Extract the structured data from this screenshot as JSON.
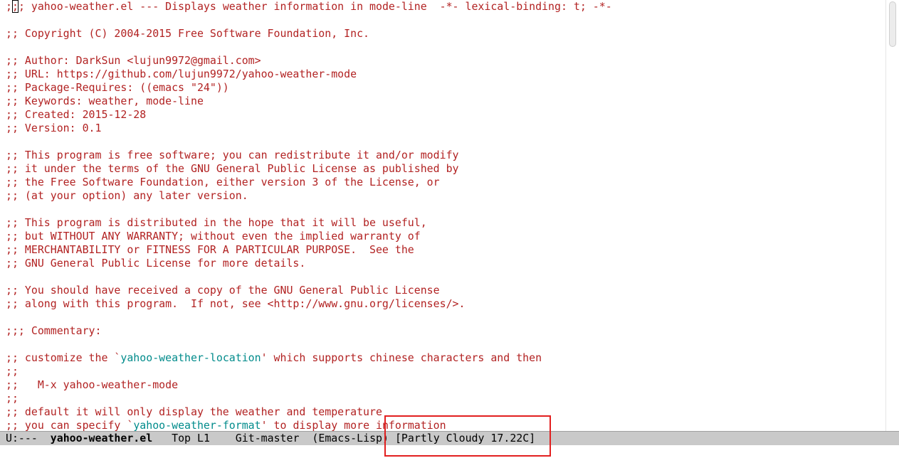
{
  "buffer": {
    "lines": [
      [
        {
          "text": ";",
          "cls": "comment"
        },
        {
          "text": ";",
          "cls": "comment cursor-char"
        },
        {
          "text": "; yahoo-weather.el --- Displays weather information in mode-line  -*- lexical-binding: t; -*-",
          "cls": "comment"
        }
      ],
      [],
      [
        {
          "text": ";; Copyright (C) 2004-2015 Free Software Foundation, Inc.",
          "cls": "comment"
        }
      ],
      [],
      [
        {
          "text": ";; Author: DarkSun <lujun9972@gmail.com>",
          "cls": "comment"
        }
      ],
      [
        {
          "text": ";; URL: https://github.com/lujun9972/yahoo-weather-mode",
          "cls": "comment"
        }
      ],
      [
        {
          "text": ";; Package-Requires: ((emacs \"24\"))",
          "cls": "comment"
        }
      ],
      [
        {
          "text": ";; Keywords: weather, mode-line",
          "cls": "comment"
        }
      ],
      [
        {
          "text": ";; Created: 2015-12-28",
          "cls": "comment"
        }
      ],
      [
        {
          "text": ";; Version: 0.1",
          "cls": "comment"
        }
      ],
      [],
      [
        {
          "text": ";; This program is free software; you can redistribute it and/or modify",
          "cls": "comment"
        }
      ],
      [
        {
          "text": ";; it under the terms of the GNU General Public License as published by",
          "cls": "comment"
        }
      ],
      [
        {
          "text": ";; the Free Software Foundation, either version 3 of the License, or",
          "cls": "comment"
        }
      ],
      [
        {
          "text": ";; (at your option) any later version.",
          "cls": "comment"
        }
      ],
      [],
      [
        {
          "text": ";; This program is distributed in the hope that it will be useful,",
          "cls": "comment"
        }
      ],
      [
        {
          "text": ";; but WITHOUT ANY WARRANTY; without even the implied warranty of",
          "cls": "comment"
        }
      ],
      [
        {
          "text": ";; MERCHANTABILITY or FITNESS FOR A PARTICULAR PURPOSE.  See the",
          "cls": "comment"
        }
      ],
      [
        {
          "text": ";; GNU General Public License for more details.",
          "cls": "comment"
        }
      ],
      [],
      [
        {
          "text": ";; You should have received a copy of the GNU General Public License",
          "cls": "comment"
        }
      ],
      [
        {
          "text": ";; along with this program.  If not, see <http://www.gnu.org/licenses/>.",
          "cls": "comment"
        }
      ],
      [],
      [
        {
          "text": ";;; Commentary:",
          "cls": "comment"
        }
      ],
      [],
      [
        {
          "text": ";; customize the `",
          "cls": "comment"
        },
        {
          "text": "yahoo-weather-location",
          "cls": "ref"
        },
        {
          "text": "' which supports chinese characters and then",
          "cls": "comment"
        }
      ],
      [
        {
          "text": ";;",
          "cls": "comment"
        }
      ],
      [
        {
          "text": ";;   M-x yahoo-weather-mode",
          "cls": "comment"
        }
      ],
      [
        {
          "text": ";;",
          "cls": "comment"
        }
      ],
      [
        {
          "text": ";; default it will only display the weather and temperature",
          "cls": "comment"
        }
      ],
      [
        {
          "text": ";; you can specify `",
          "cls": "comment"
        },
        {
          "text": "yahoo-weather-format",
          "cls": "ref"
        },
        {
          "text": "' to display more information",
          "cls": "comment"
        }
      ]
    ]
  },
  "modeline": {
    "status": "U:---",
    "buffer_name": "yahoo-weather.el",
    "position": "Top L1",
    "vcs": "Git-master",
    "major_mode": "(Emacs-Lisp)",
    "weather": "[Partly Cloudy 17.22C]"
  },
  "colors": {
    "comment": "#b22222",
    "reference": "#008b8b",
    "modeline_bg": "#c9c9c9",
    "highlight_box": "#e21f1f"
  }
}
